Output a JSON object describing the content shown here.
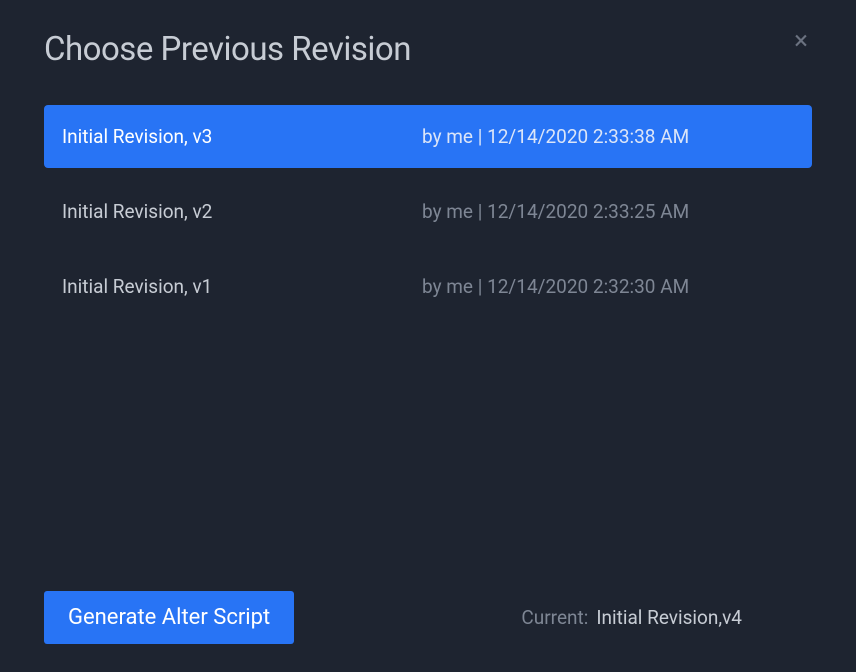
{
  "dialog": {
    "title": "Choose Previous Revision",
    "close": "×"
  },
  "revisions": [
    {
      "label": "Initial Revision, v3",
      "meta": "by me | 12/14/2020 2:33:38 AM",
      "selected": true
    },
    {
      "label": "Initial Revision, v2",
      "meta": "by me | 12/14/2020 2:33:25 AM",
      "selected": false
    },
    {
      "label": "Initial Revision, v1",
      "meta": "by me | 12/14/2020 2:32:30 AM",
      "selected": false
    }
  ],
  "footer": {
    "generate_label": "Generate Alter Script",
    "current_label": "Current:",
    "current_value": "Initial Revision,v4"
  }
}
